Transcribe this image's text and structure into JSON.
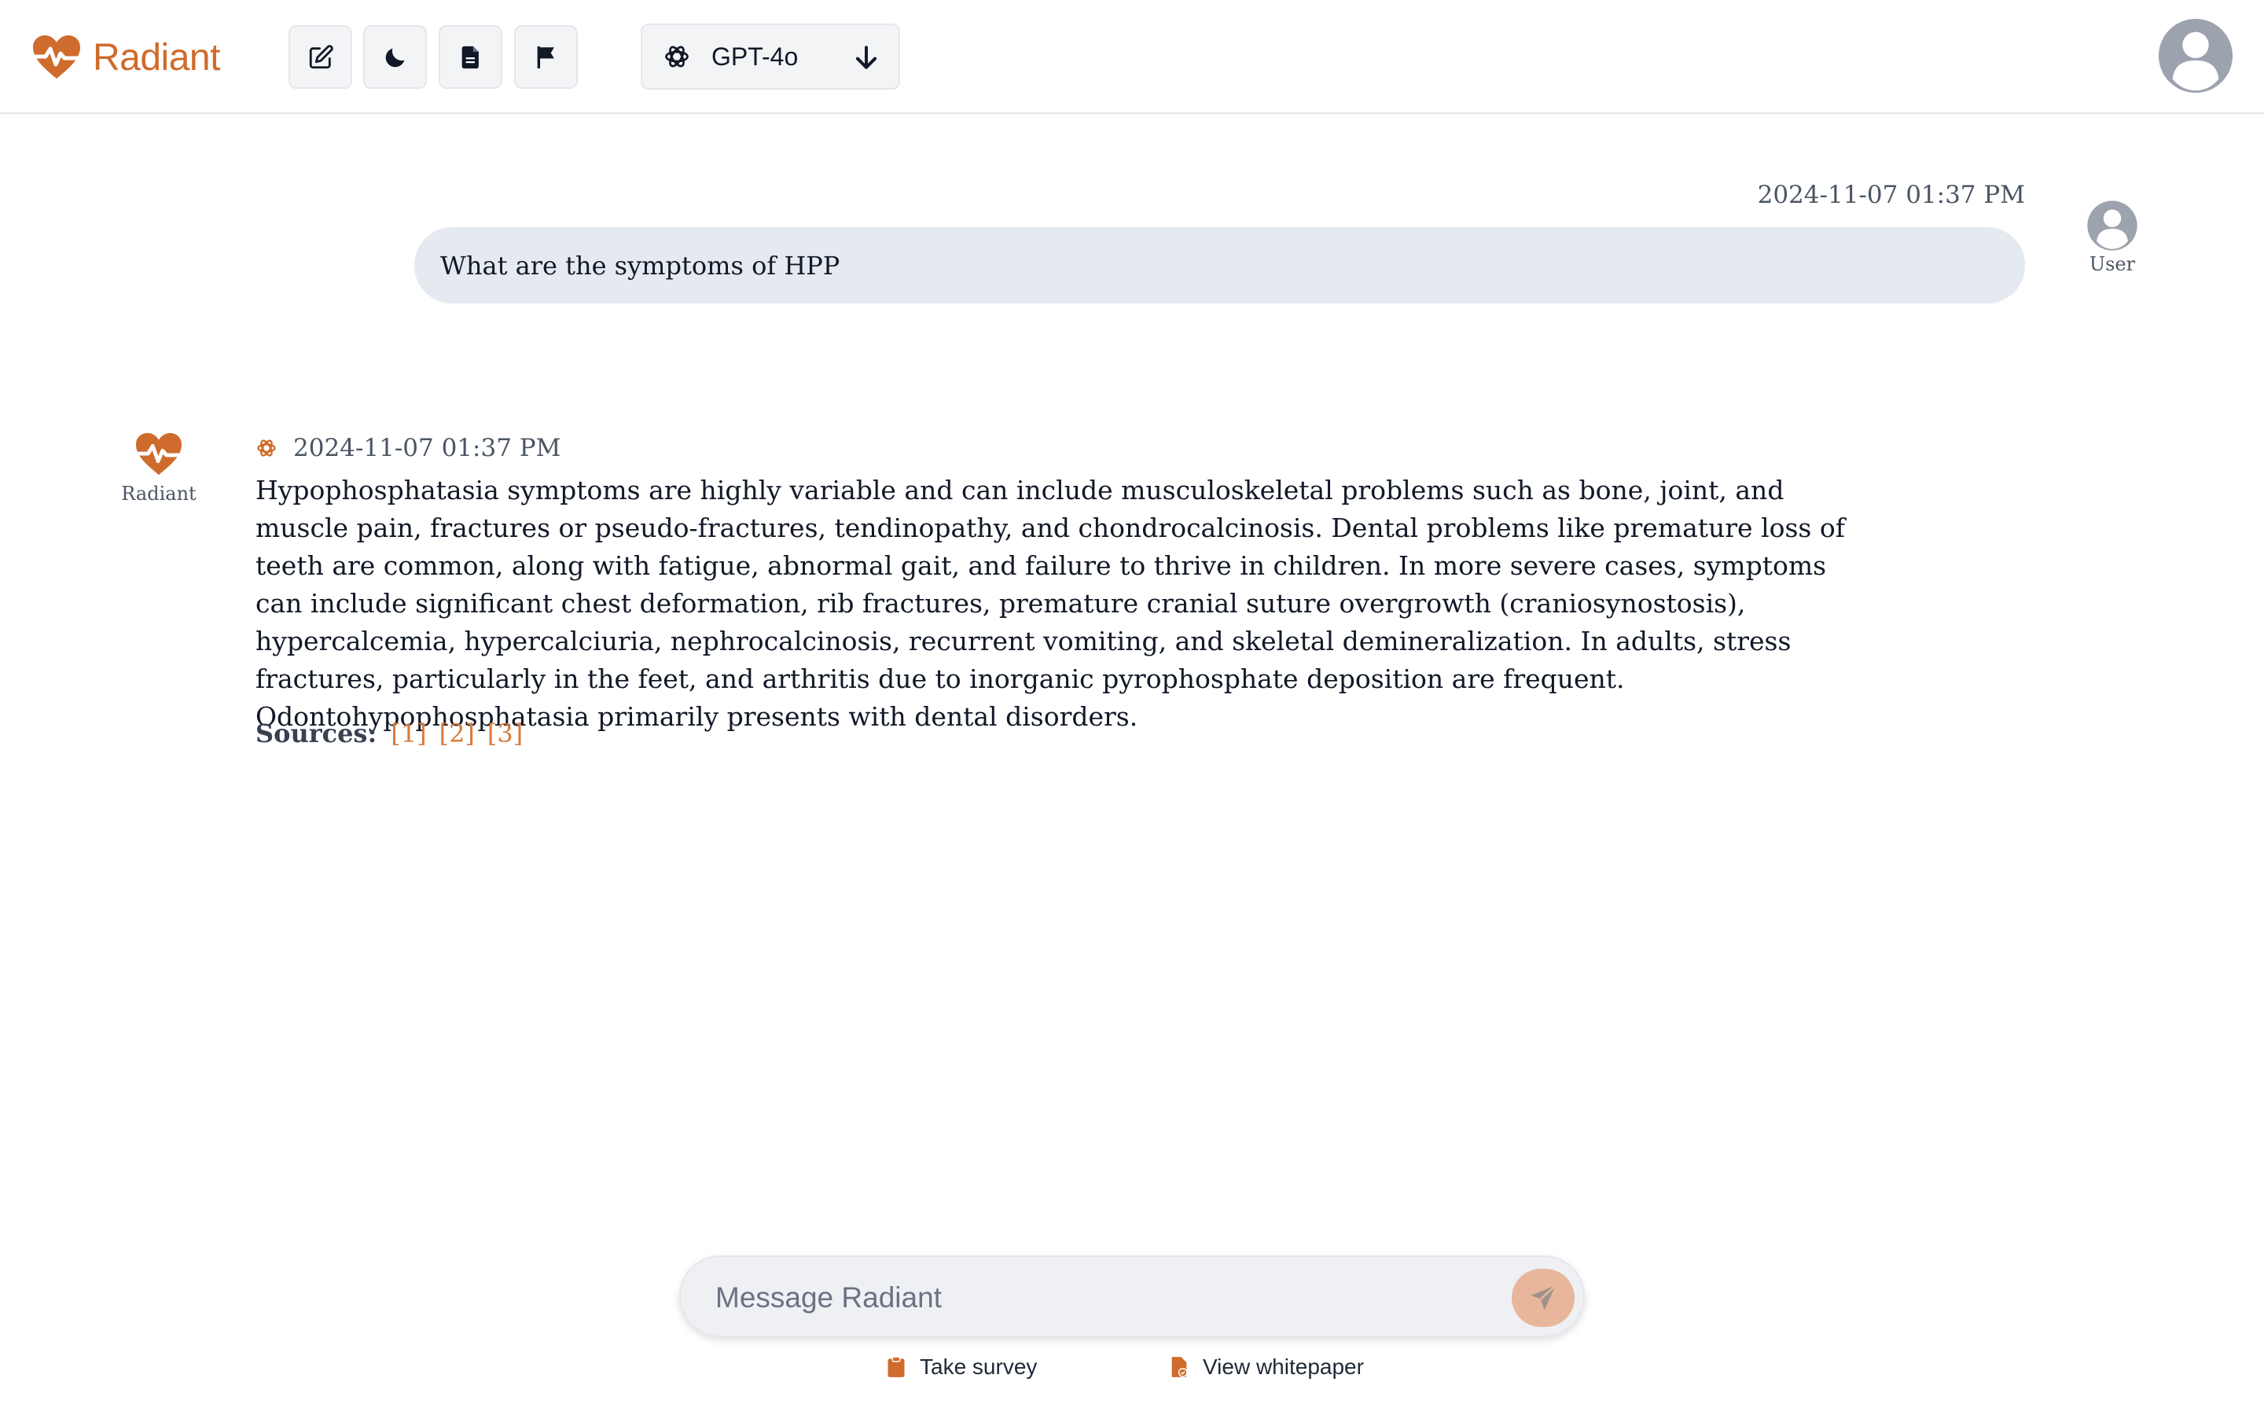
{
  "app": {
    "name": "Radiant",
    "brand_color": "#cf6b2c"
  },
  "header": {
    "tools": [
      {
        "name": "new-chat",
        "icon": "edit-icon"
      },
      {
        "name": "dark-mode",
        "icon": "moon-icon"
      },
      {
        "name": "documents",
        "icon": "document-icon"
      },
      {
        "name": "report",
        "icon": "flag-icon"
      }
    ],
    "model_selector": {
      "selected": "GPT-4o",
      "icon": "openai-icon",
      "arrow_icon": "arrow-down-icon"
    },
    "profile_icon": "user-avatar-icon"
  },
  "conversation": {
    "user_message": {
      "timestamp": "2024-11-07 01:37 PM",
      "text": "What are the symptoms of HPP",
      "sender_label": "User"
    },
    "assistant_message": {
      "sender_label": "Radiant",
      "timestamp": "2024-11-07 01:37 PM",
      "text": "Hypophosphatasia symptoms are highly variable and can include musculoskeletal problems such as bone, joint, and muscle pain, fractures or pseudo-fractures, tendinopathy, and chondrocalcinosis. Dental problems like premature loss of teeth are common, along with fatigue, abnormal gait, and failure to thrive in children. In more severe cases, symptoms can include significant chest deformation, rib fractures, premature cranial suture overgrowth (craniosynostosis), hypercalcemia, hypercalciuria, nephrocalcinosis, recurrent vomiting, and skeletal demineralization. In adults, stress fractures, particularly in the feet, and arthritis due to inorganic pyrophosphate deposition are frequent. Odontohypophosphatasia primarily presents with dental disorders.",
      "sources_label": "Sources:",
      "sources": [
        "[1]",
        "[2]",
        "[3]"
      ]
    }
  },
  "composer": {
    "placeholder": "Message Radiant",
    "value": ""
  },
  "footer": {
    "survey_label": "Take survey",
    "whitepaper_label": "View whitepaper"
  }
}
